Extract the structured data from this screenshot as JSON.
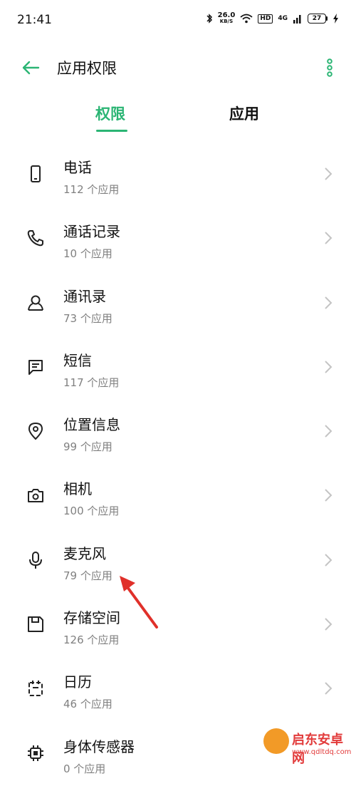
{
  "status_bar": {
    "time": "21:41",
    "speed_value": "26.0",
    "speed_unit": "KB/S",
    "hd": "HD",
    "network": "4G",
    "battery": "27"
  },
  "header": {
    "title": "应用权限"
  },
  "tabs": [
    {
      "label": "权限",
      "active": true
    },
    {
      "label": "应用",
      "active": false
    }
  ],
  "permissions": [
    {
      "title": "电话",
      "subtitle": "112 个应用",
      "icon": "phone-device-icon"
    },
    {
      "title": "通话记录",
      "subtitle": "10 个应用",
      "icon": "call-log-icon"
    },
    {
      "title": "通讯录",
      "subtitle": "73 个应用",
      "icon": "contacts-icon"
    },
    {
      "title": "短信",
      "subtitle": "117 个应用",
      "icon": "sms-icon"
    },
    {
      "title": "位置信息",
      "subtitle": "99 个应用",
      "icon": "location-icon"
    },
    {
      "title": "相机",
      "subtitle": "100 个应用",
      "icon": "camera-icon"
    },
    {
      "title": "麦克风",
      "subtitle": "79 个应用",
      "icon": "microphone-icon"
    },
    {
      "title": "存储空间",
      "subtitle": "126 个应用",
      "icon": "storage-icon"
    },
    {
      "title": "日历",
      "subtitle": "46 个应用",
      "icon": "calendar-icon"
    },
    {
      "title": "身体传感器",
      "subtitle": "0 个应用",
      "icon": "body-sensor-icon"
    }
  ],
  "watermark": {
    "text": "启东安卓网",
    "url": "www.qdltdq.com"
  },
  "colors": {
    "accent": "#2bb574",
    "annotation_arrow": "#e0302a"
  }
}
